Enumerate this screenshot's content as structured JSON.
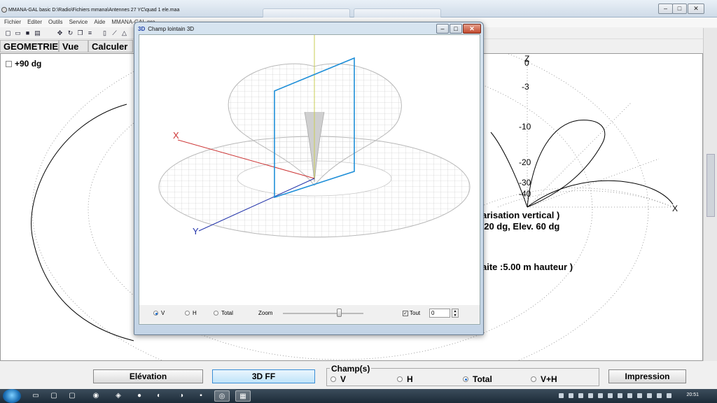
{
  "window": {
    "title": "MMANA-GAL basic D:\\Radio\\Fichiers mmana\\Antennes 27 YC\\quad 1 ele.maa",
    "min": "–",
    "max": "□",
    "close": "✕"
  },
  "menu": [
    "Fichier",
    "Editer",
    "Outils",
    "Service",
    "Aide",
    "MMANA-GAL.pro"
  ],
  "tabs": [
    "GEOMETRIE",
    "Vue",
    "Calculer"
  ],
  "checkbox_label": "+90 dg",
  "plot": {
    "axis_z": "Z",
    "axis_x": "X",
    "scale": [
      "0",
      "-3",
      "-10",
      "-20",
      "-30",
      "-40"
    ]
  },
  "info": {
    "line1": "arisation vertical )",
    "line2": "120 dg, Elev. 60 dg",
    "line3": "aite   :5.00 m hauteur )"
  },
  "dialog": {
    "title_prefix": "3D",
    "title": "Champ lointain 3D",
    "axis_x": "X",
    "axis_y": "Y",
    "radio_v": "V",
    "radio_h": "H",
    "radio_total": "Total",
    "zoom_label": "Zoom",
    "tout_label": "Tout",
    "spin_value": "0"
  },
  "bottom": {
    "elevation": "Elévation",
    "ff3d": "3D FF",
    "champs": "Champ(s)",
    "radio_v": "V",
    "radio_h": "H",
    "radio_total": "Total",
    "radio_vh": "V+H",
    "impression": "Impression"
  },
  "taskbar": {
    "clock": "20:51"
  },
  "colors": {
    "plot_line": "#000000",
    "x_axis": "#cc3333",
    "y_axis": "#2233aa",
    "plane": "#1f8fd8",
    "mesh": "#bdbdbd"
  }
}
